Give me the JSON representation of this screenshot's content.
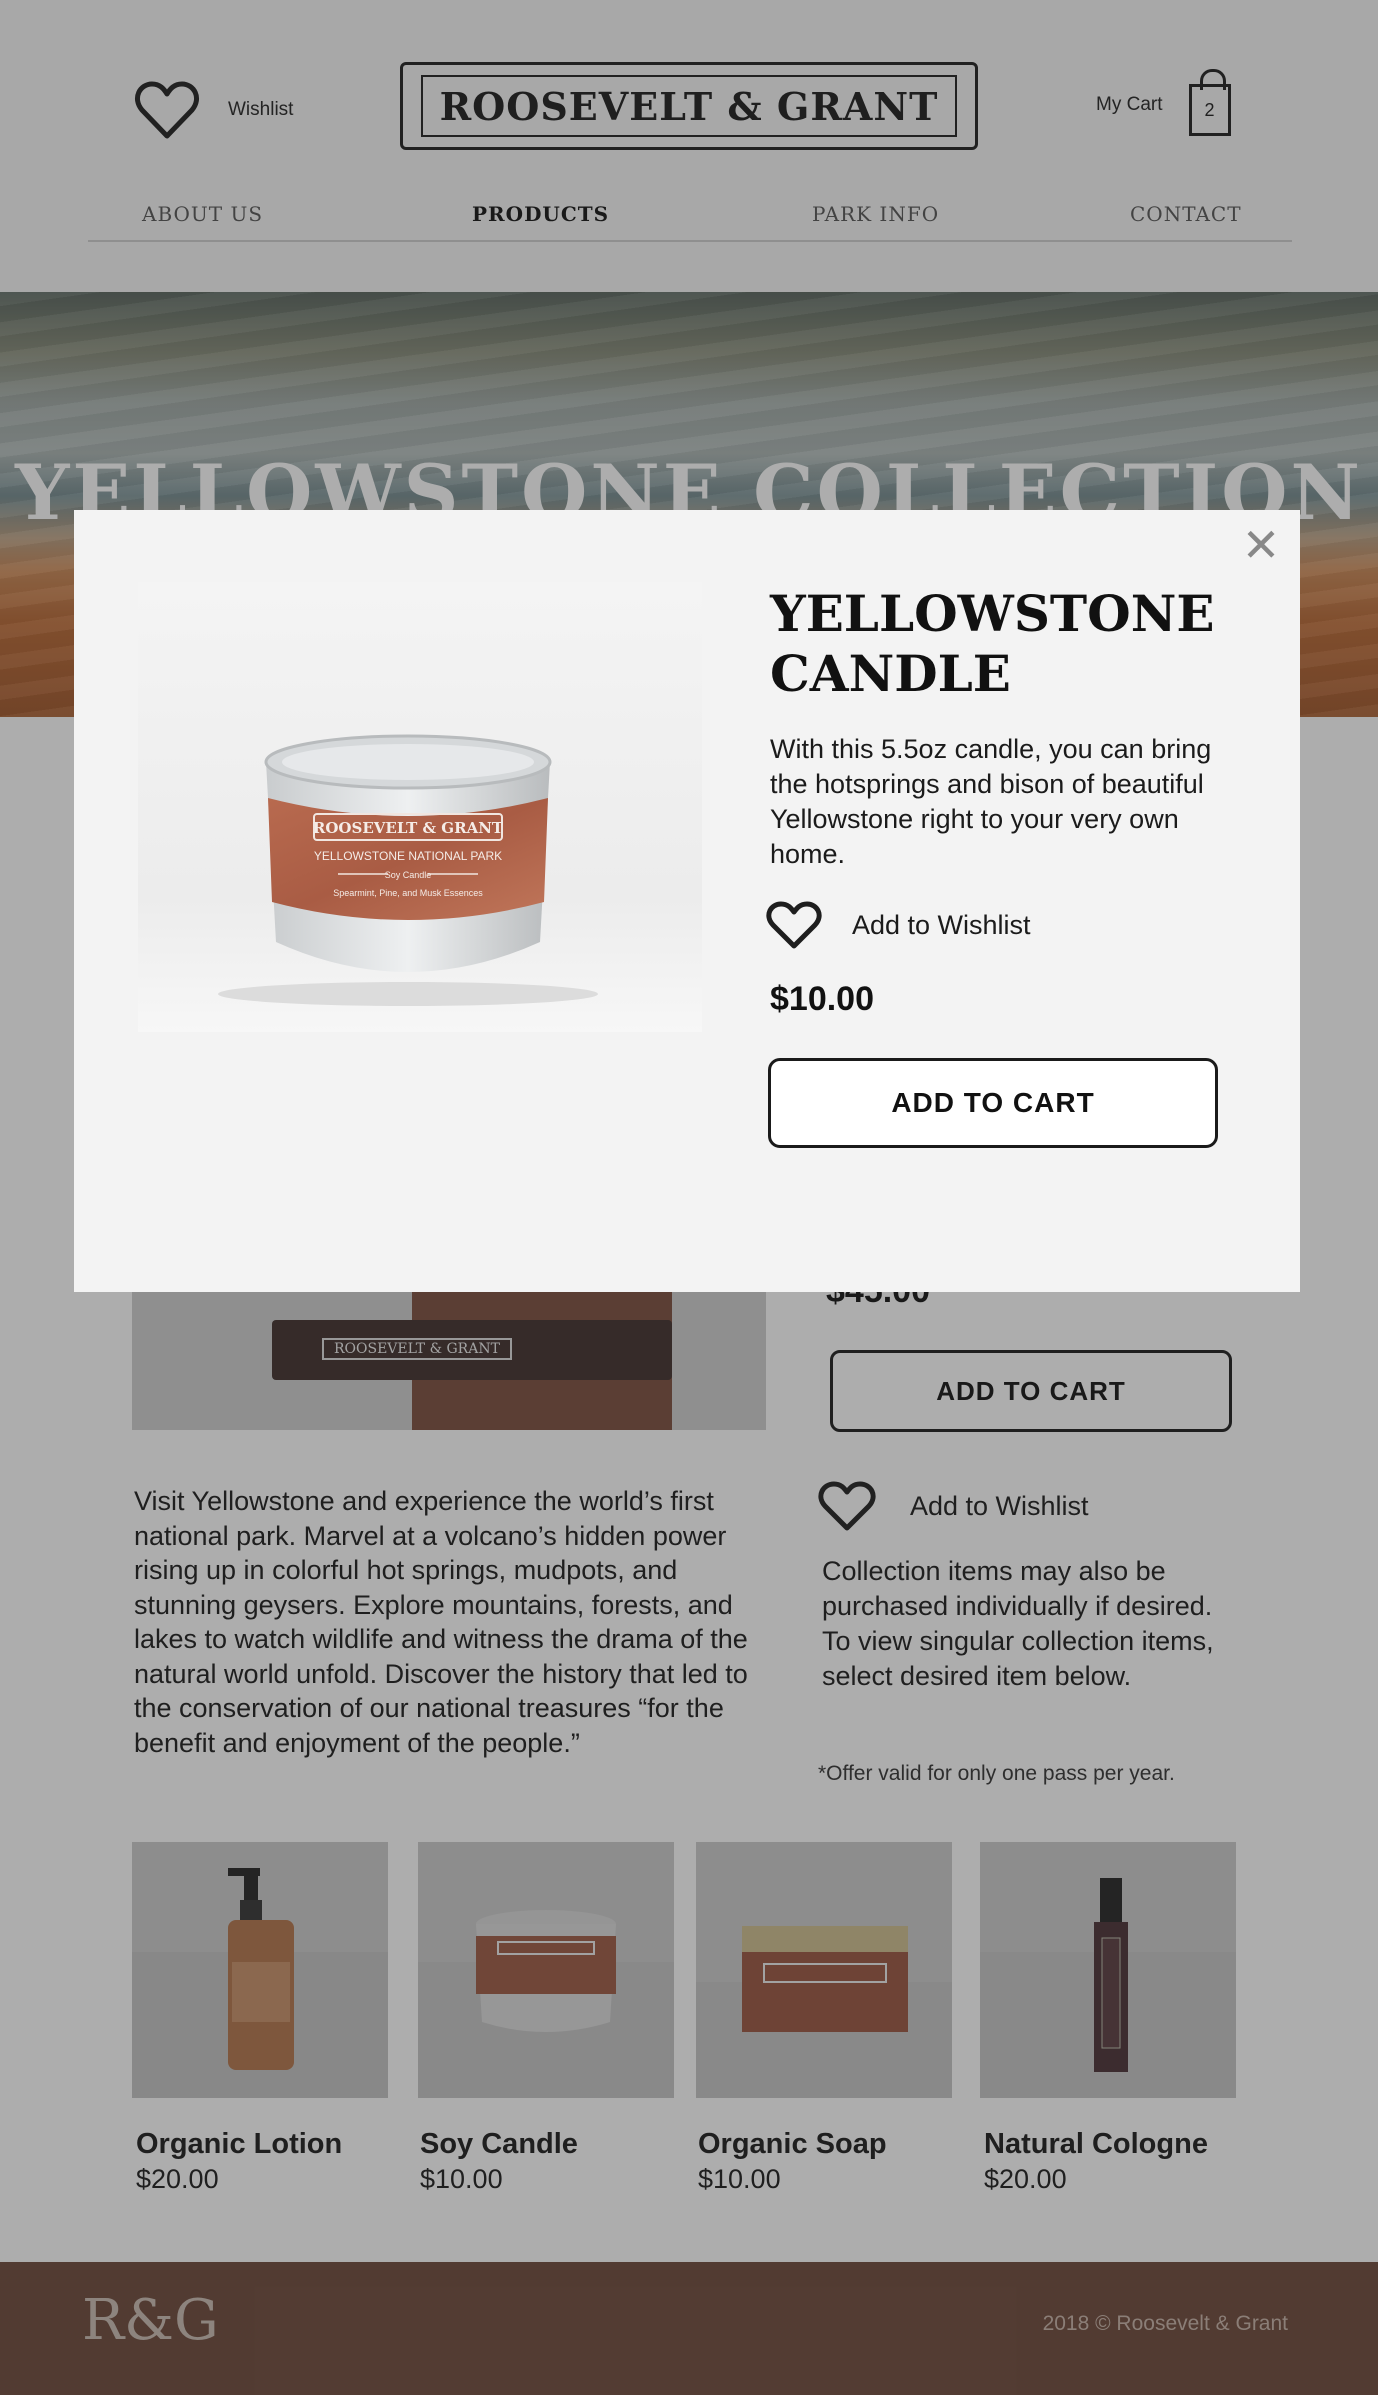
{
  "header": {
    "wishlist_label": "Wishlist",
    "logo_text": "ROOSEVELT & GRANT",
    "cart_label": "My Cart",
    "cart_count": "2"
  },
  "nav": {
    "items": [
      {
        "label": "ABOUT US"
      },
      {
        "label": "PRODUCTS"
      },
      {
        "label": "PARK INFO"
      },
      {
        "label": "CONTACT"
      }
    ],
    "active": "PRODUCTS"
  },
  "hero": {
    "title": "YELLOWSTONE COLLECTION"
  },
  "collection": {
    "price": "$45.00",
    "add_to_cart": "ADD TO CART",
    "add_to_wishlist": "Add to Wishlist",
    "description": "Visit Yellowstone and experience the world’s first national park. Marvel at a volcano’s hidden power rising up in colorful hot springs, mudpots, and stunning geysers. Explore mountains, forests, and lakes to watch wildlife and witness the drama of the natural world unfold. Discover the history that led to the conservation of our national treasures “for the benefit and enjoyment of the people.”",
    "note": "Collection items may also be purchased individually if desired. To view singular collection items, select desired item below.",
    "offer": "*Offer valid for only one pass per year.",
    "box_label": "ROOSEVELT & GRANT"
  },
  "products": [
    {
      "name": "Organic Lotion",
      "price": "$20.00"
    },
    {
      "name": "Soy Candle",
      "price": "$10.00"
    },
    {
      "name": "Organic Soap",
      "price": "$10.00"
    },
    {
      "name": "Natural Cologne",
      "price": "$20.00"
    }
  ],
  "footer": {
    "monogram": "R&G",
    "copyright": "2018 © Roosevelt & Grant"
  },
  "modal": {
    "title": "YELLOWSTONE CANDLE",
    "description": "With this 5.5oz candle, you can bring the hotsprings and bison of beautiful Yellowstone right to your very own home.",
    "add_to_wishlist": "Add to Wishlist",
    "price": "$10.00",
    "add_to_cart": "ADD TO CART",
    "close_symbol": "✕",
    "label_brand": "ROOSEVELT & GRANT",
    "label_park": "YELLOWSTONE NATIONAL PARK",
    "label_type": "Soy Candle",
    "label_scent": "Spearmint, Pine, and Musk Essences"
  },
  "colors": {
    "footer_bg": "#6d4839",
    "label_brown": "#b0644a",
    "overlay": "rgba(40,40,40,0.38)"
  }
}
